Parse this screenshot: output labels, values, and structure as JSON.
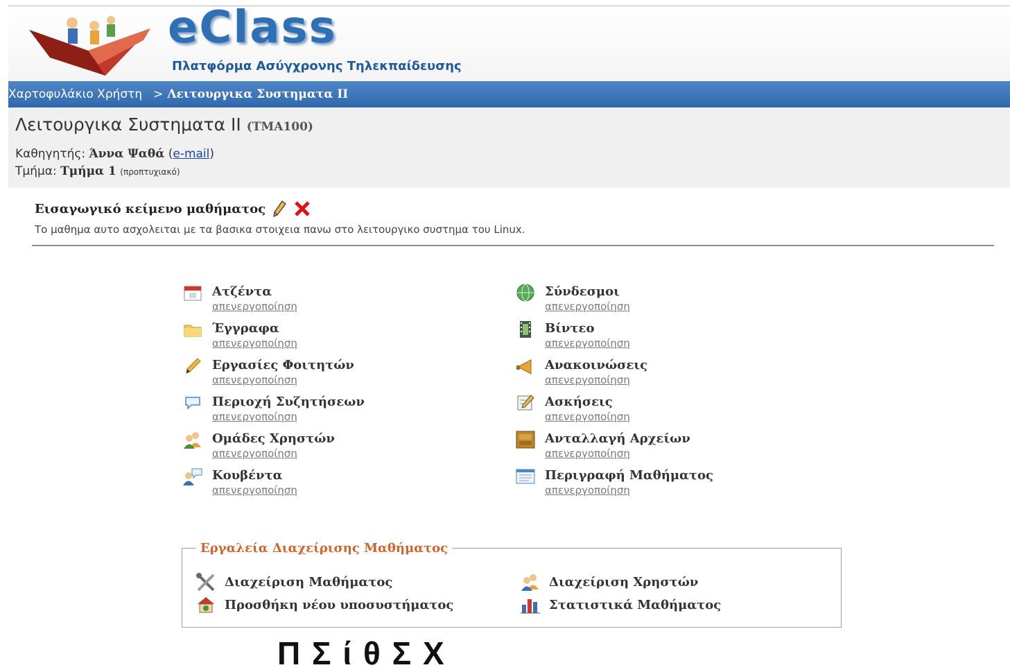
{
  "header": {
    "logo_text": "eClass",
    "tagline": "Πλατφόρμα Ασύγχρονης Τηλεκπαίδευσης"
  },
  "breadcrumb": {
    "home": "Χαρτοφυλάκιο Χρήστη",
    "separator": ">",
    "current": "Λειτουργικα Συστηματα ΙΙ"
  },
  "course": {
    "title": "Λειτουργικα Συστηματα ΙΙ",
    "code": "(ΤΜΑ100)",
    "professor_label": "Καθηγητής:",
    "professor_name": "Άννα Ψαθά",
    "email_link": "e-mail",
    "department_label": "Τμήμα:",
    "department_name": "Τμήμα 1",
    "level": "(προπτυχιακό)"
  },
  "intro": {
    "heading": "Εισαγωγικό κείμενο μαθήματος",
    "text": "Το μαθημα αυτο ασχολειται με τα βασικα στοιχεια πανω στο λειτουργικο συστημα του Linux."
  },
  "tools_left": [
    {
      "name": "Ατζέντα",
      "link": "απενεργοποίηση",
      "icon": "calendar-icon"
    },
    {
      "name": "Έγγραφα",
      "link": "απενεργοποίηση",
      "icon": "folder-icon"
    },
    {
      "name": "Εργασίες Φοιτητών",
      "link": "απενεργοποίηση",
      "icon": "pencil-icon"
    },
    {
      "name": "Περιοχή Συζητήσεων",
      "link": "απενεργοποίηση",
      "icon": "speech-bubble-icon"
    },
    {
      "name": "Ομάδες Χρηστών",
      "link": "απενεργοποίηση",
      "icon": "users-icon"
    },
    {
      "name": "Κουβέντα",
      "link": "απενεργοποίηση",
      "icon": "chat-user-icon"
    }
  ],
  "tools_right": [
    {
      "name": "Σύνδεσμοι",
      "link": "απενεργοποίηση",
      "icon": "globe-icon"
    },
    {
      "name": "Βίντεο",
      "link": "απενεργοποίηση",
      "icon": "film-icon"
    },
    {
      "name": "Ανακοινώσεις",
      "link": "απενεργοποίηση",
      "icon": "megaphone-icon"
    },
    {
      "name": "Ασκήσεις",
      "link": "απενεργοποίηση",
      "icon": "notepad-icon"
    },
    {
      "name": "Ανταλλαγή Αρχείων",
      "link": "απενεργοποίηση",
      "icon": "file-exchange-icon"
    },
    {
      "name": "Περιγραφή Μαθήματος",
      "link": "απενεργοποίηση",
      "icon": "description-icon"
    }
  ],
  "admin": {
    "legend": "Εργαλεία Διαχείρισης Μαθήματος",
    "items": [
      {
        "label": "Διαχείριση Μαθήματος",
        "icon": "tools-icon"
      },
      {
        "label": "Διαχείριση Χρηστών",
        "icon": "users-icon"
      },
      {
        "label": "Προσθήκη νέου υποσυστήματος",
        "icon": "add-module-icon"
      },
      {
        "label": "Στατιστικά Μαθήματος",
        "icon": "bar-chart-icon"
      }
    ]
  },
  "caption": "Π Σ            ί   θ   Σ            Χ"
}
